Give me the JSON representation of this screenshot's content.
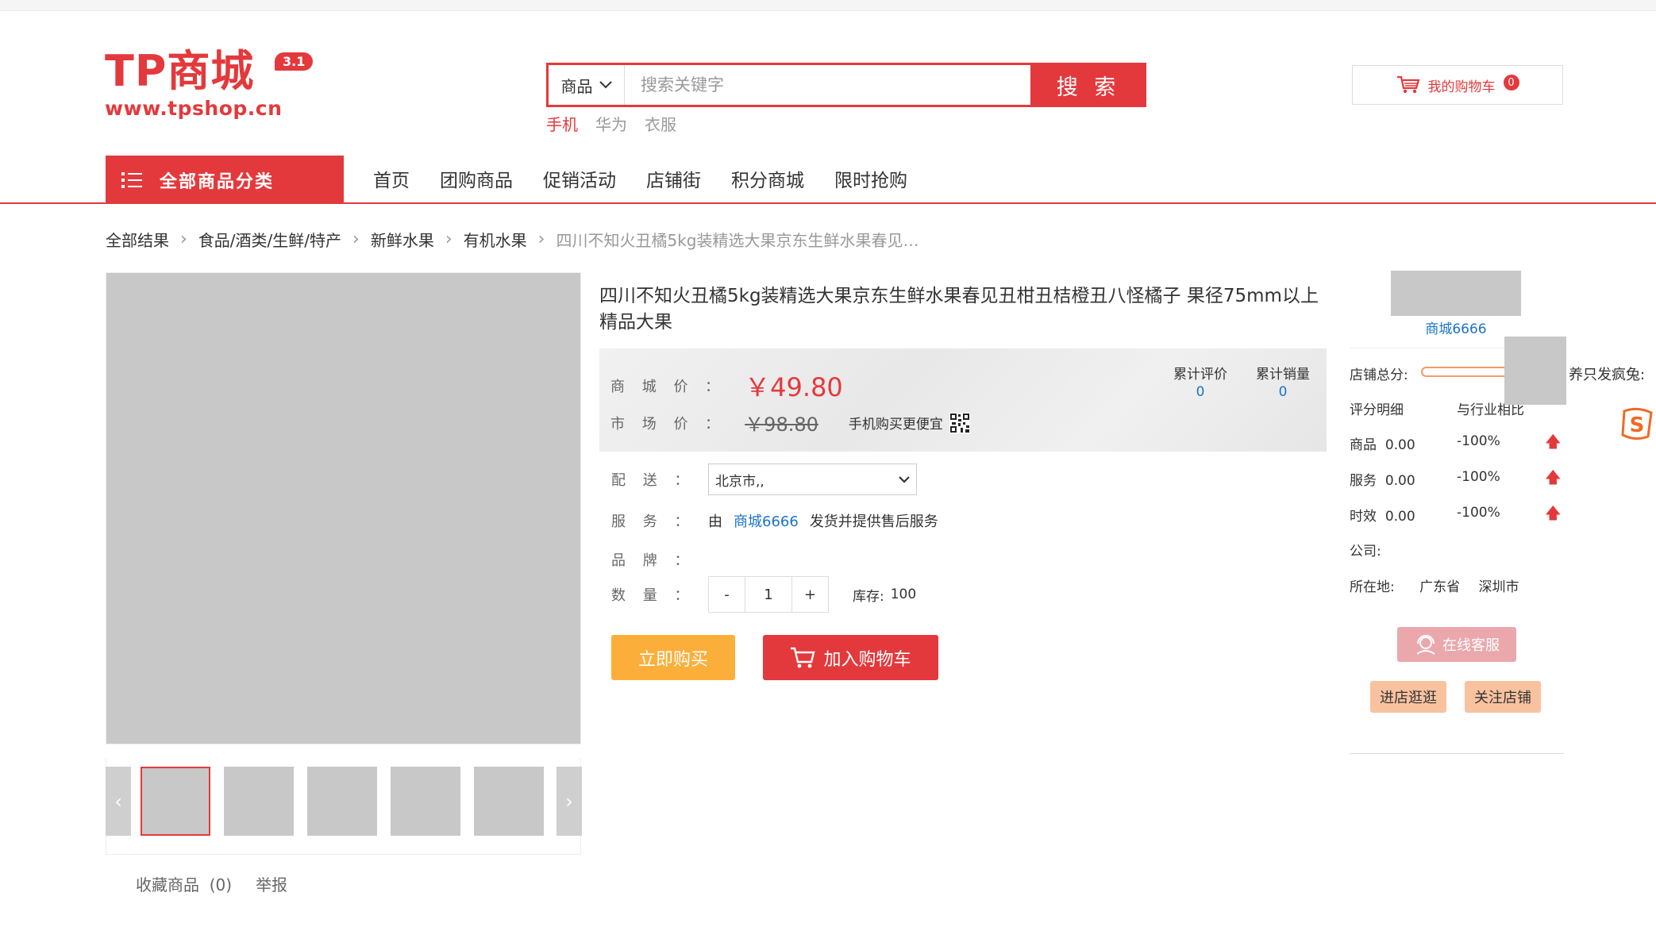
{
  "header": {
    "logo_text": "TP商城",
    "logo_version": "3.1",
    "logo_url": "www.tpshop.cn",
    "search": {
      "category": "商品",
      "placeholder": "搜索关键字",
      "button": "搜 索",
      "hotwords": [
        "手机",
        "华为",
        "衣服"
      ]
    },
    "cart": {
      "label": "我的购物车",
      "count": "0"
    }
  },
  "nav": {
    "all_categories": "全部商品分类",
    "items": [
      "首页",
      "团购商品",
      "促销活动",
      "店铺街",
      "积分商城",
      "限时抢购"
    ]
  },
  "breadcrumb": [
    "全部结果",
    "食品/酒类/生鲜/特产",
    "新鲜水果",
    "有机水果",
    "四川不知火丑橘5kg装精选大果京东生鲜水果春见…"
  ],
  "gallery": {
    "main_image": "",
    "thumbnails": [
      "",
      "",
      "",
      "",
      ""
    ]
  },
  "collect": {
    "label": "收藏商品",
    "count": "(0)",
    "report": "举报"
  },
  "product": {
    "title": "四川不知火丑橘5kg装精选大果京东生鲜水果春见丑柑丑桔橙丑八怪橘子 果径75mm以上 精品大果",
    "price_label": "商 城 价 ：",
    "price": "￥49.80",
    "market_label": "市 场 价 ：",
    "market_price": "￥98.80",
    "mobile_cheaper": "手机购买更便宜",
    "reviews_label": "累计评价",
    "reviews_count": "0",
    "sales_label": "累计销量",
    "sales_count": "0",
    "delivery_label": "配 送 ：",
    "delivery_value": "北京市,,",
    "service_label": "服 务 ：",
    "service_prefix": "由",
    "service_shop": "商城6666",
    "service_suffix": "发货并提供售后服务",
    "brand_label": "品 牌 ：",
    "qty_label": "数 量 ：",
    "qty_minus": "-",
    "qty_value": "1",
    "qty_plus": "+",
    "stock_label": "库存:",
    "stock_value": "100",
    "buy_now": "立即购买",
    "add_to_cart": "加入购物车"
  },
  "shop": {
    "name": "商城6666",
    "score_label": "店铺总分:",
    "detail_label": "评分明细",
    "compare_label": "与行业相比",
    "scores": [
      {
        "name": "商品",
        "value": "0.00",
        "compare": "-100%"
      },
      {
        "name": "服务",
        "value": "0.00",
        "compare": "-100%"
      },
      {
        "name": "时效",
        "value": "0.00",
        "compare": "-100%"
      }
    ],
    "company_label": "公司:",
    "location_label": "所在地:",
    "province": "广东省",
    "city": "深圳市",
    "online_service": "在线客服",
    "visit_shop": "进店逛逛",
    "follow_shop": "关注店铺"
  },
  "overlay": {
    "bubble_text": "养只发疯兔:"
  },
  "colors": {
    "accent": "#e4393c",
    "buy_now": "#fbaf3a",
    "link": "#1a73c8"
  }
}
